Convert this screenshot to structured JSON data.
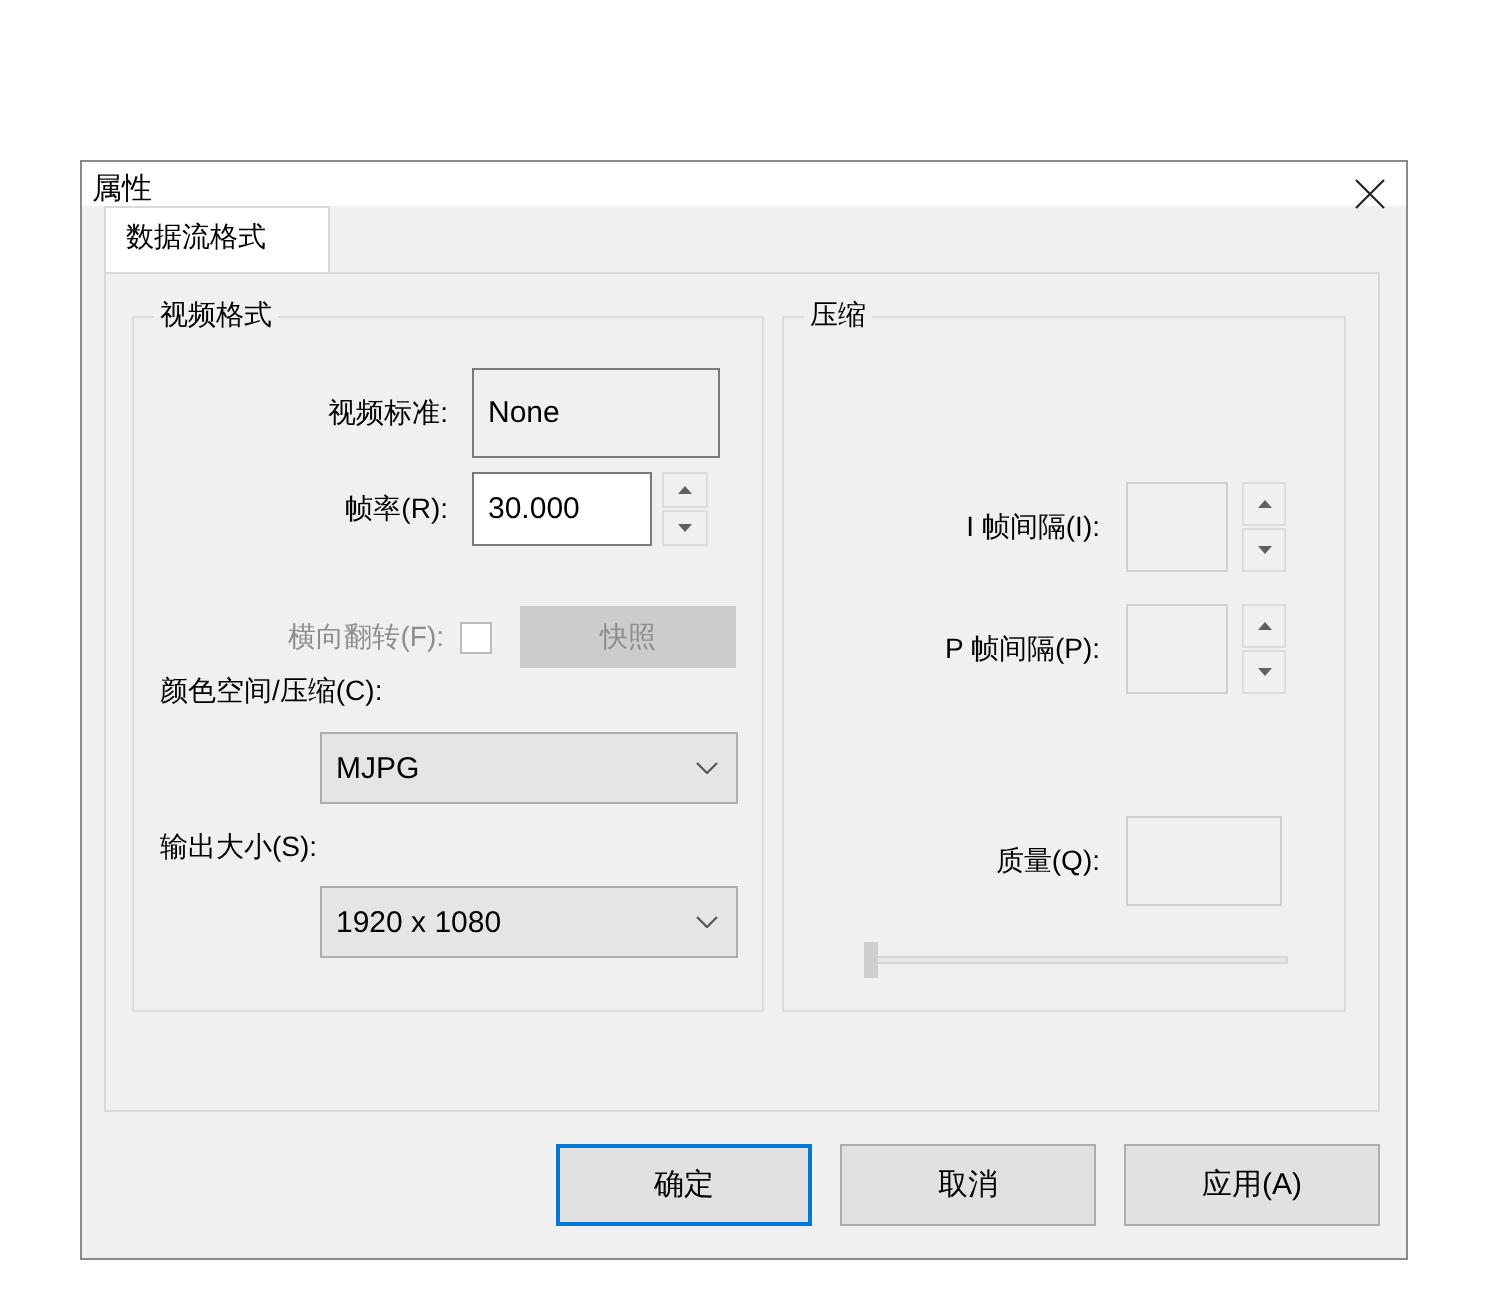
{
  "window": {
    "title": "属性"
  },
  "tabs": [
    {
      "label": "数据流格式",
      "selected": true
    }
  ],
  "video_format": {
    "title": "视频格式",
    "standard": {
      "label": "视频标准:",
      "value": "None"
    },
    "frame_rate": {
      "label": "帧率(R):",
      "value": "30.000"
    },
    "flip": {
      "label": "横向翻转(F):",
      "checked": false,
      "disabled": true
    },
    "snapshot_button": {
      "label": "快照",
      "disabled": true
    },
    "color_space": {
      "label": "颜色空间/压缩(C):",
      "value": "MJPG"
    },
    "output_size": {
      "label": "输出大小(S):",
      "value": "1920 x 1080"
    }
  },
  "compression": {
    "title": "压缩",
    "i_frame_interval": {
      "label": "I 帧间隔(I):",
      "disabled": true
    },
    "p_frame_interval": {
      "label": "P 帧间隔(P):",
      "disabled": true
    },
    "quality": {
      "label": "质量(Q):",
      "disabled": true
    },
    "quality_slider": {
      "level": 0
    }
  },
  "buttons": [
    {
      "label": "确定",
      "default": true
    },
    {
      "label": "取消",
      "default": false
    },
    {
      "label": "应用(A)",
      "default": false
    }
  ]
}
